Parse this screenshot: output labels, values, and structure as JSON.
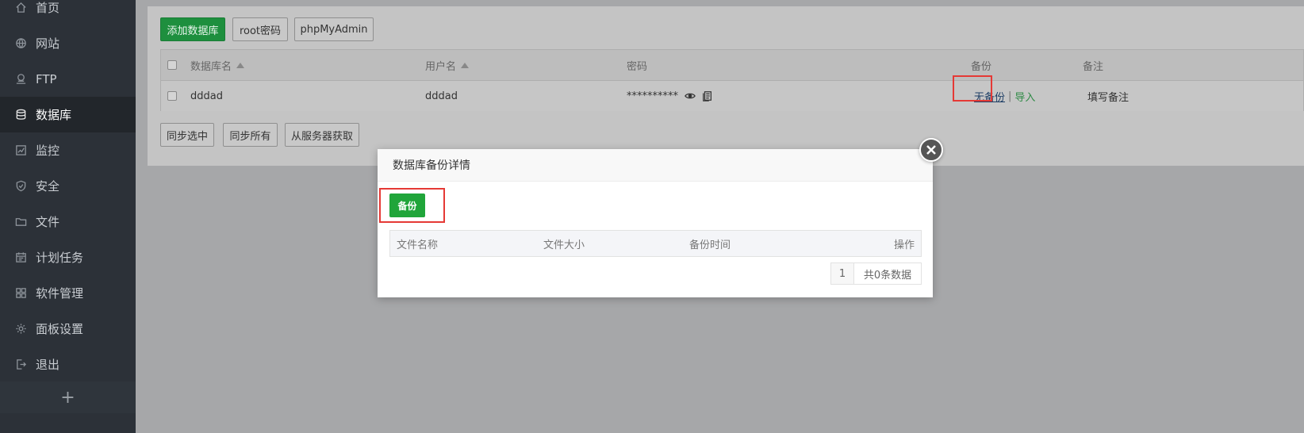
{
  "sidebar": {
    "items": [
      {
        "label": "首页",
        "icon": "home-icon"
      },
      {
        "label": "网站",
        "icon": "globe-icon"
      },
      {
        "label": "FTP",
        "icon": "ftp-icon"
      },
      {
        "label": "数据库",
        "icon": "database-icon",
        "active": true
      },
      {
        "label": "监控",
        "icon": "monitor-chart-icon"
      },
      {
        "label": "安全",
        "icon": "shield-icon"
      },
      {
        "label": "文件",
        "icon": "folder-icon"
      },
      {
        "label": "计划任务",
        "icon": "calendar-icon"
      },
      {
        "label": "软件管理",
        "icon": "grid-icon"
      },
      {
        "label": "面板设置",
        "icon": "gear-icon"
      },
      {
        "label": "退出",
        "icon": "logout-icon"
      }
    ],
    "add_label": "+"
  },
  "toolbar": {
    "add_db": "添加数据库",
    "root_pwd": "root密码",
    "phpmyadmin": "phpMyAdmin"
  },
  "table": {
    "headers": {
      "name": "数据库名",
      "user": "用户名",
      "password": "密码",
      "backup": "备份",
      "note": "备注"
    },
    "rows": [
      {
        "name": "dddad",
        "user": "dddad",
        "password": "**********",
        "backup_status": "无备份",
        "separator": "|",
        "import": "导入",
        "note": "填写备注"
      }
    ]
  },
  "bottom_buttons": {
    "sync_selected": "同步选中",
    "sync_all": "同步所有",
    "fetch_server": "从服务器获取"
  },
  "modal": {
    "title": "数据库备份详情",
    "backup_button": "备份",
    "columns": {
      "file_name": "文件名称",
      "file_size": "文件大小",
      "backup_time": "备份时间",
      "action": "操作"
    },
    "pager": {
      "page": "1",
      "total": "共0条数据"
    }
  },
  "colors": {
    "accent_green": "#20a53a",
    "highlight_red": "#e53935",
    "sidebar_bg": "#2c3138"
  }
}
